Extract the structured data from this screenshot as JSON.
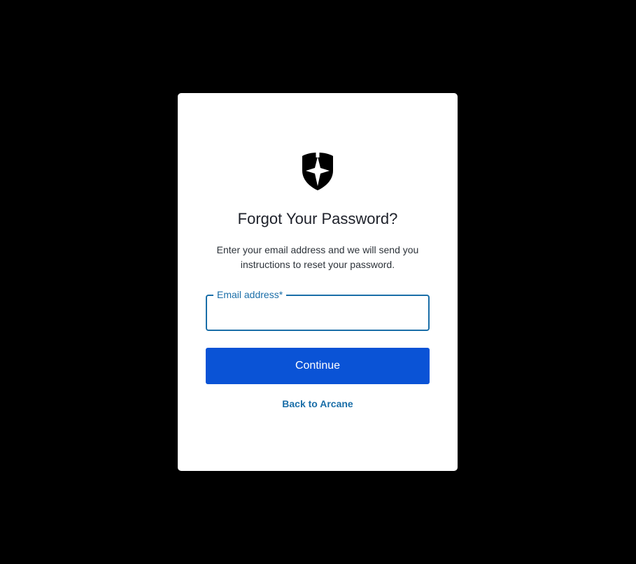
{
  "card": {
    "logo_icon": "shield-logo-icon",
    "title": "Forgot Your Password?",
    "description": "Enter your email address and we will send you instructions to reset your password.",
    "email_field": {
      "label": "Email address*",
      "value": "",
      "placeholder": ""
    },
    "continue_label": "Continue",
    "back_link_label": "Back to Arcane"
  },
  "colors": {
    "background": "#000000",
    "card": "#ffffff",
    "primary_button": "#0a53d6",
    "accent": "#1a6ea8",
    "title_text": "#1e212a"
  }
}
